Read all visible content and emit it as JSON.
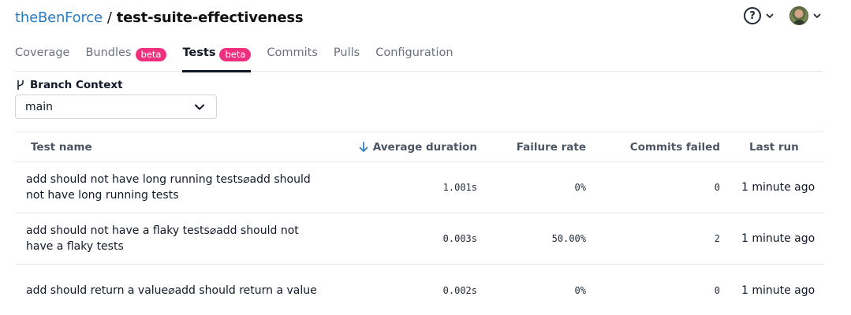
{
  "breadcrumb": {
    "org": "theBenForce",
    "separator": "/",
    "repo": "test-suite-effectiveness"
  },
  "tabs": [
    {
      "label": "Coverage",
      "badge": ""
    },
    {
      "label": "Bundles",
      "badge": "beta"
    },
    {
      "label": "Tests",
      "badge": "beta",
      "active": true
    },
    {
      "label": "Commits",
      "badge": ""
    },
    {
      "label": "Pulls",
      "badge": ""
    },
    {
      "label": "Configuration",
      "badge": ""
    }
  ],
  "help_glyph": "?",
  "branch": {
    "label": "Branch Context",
    "selected": "main"
  },
  "table": {
    "headers": {
      "name": "Test name",
      "duration": "Average duration",
      "failure": "Failure rate",
      "commits": "Commits failed",
      "last_run": "Last run"
    },
    "rows": [
      {
        "name": "add should not have long running tests⌀add should not have long running tests",
        "duration": "1.001s",
        "failure": "0%",
        "commits": "0",
        "last_run": "1 minute ago"
      },
      {
        "name": "add should not have a flaky tests⌀add should not have a flaky tests",
        "duration": "0.003s",
        "failure": "50.00%",
        "commits": "2",
        "last_run": "1 minute ago"
      },
      {
        "name": "add should return a value⌀add should return a value",
        "duration": "0.002s",
        "failure": "0%",
        "commits": "0",
        "last_run": "1 minute ago"
      }
    ]
  },
  "colors": {
    "org_link": "#2a7bbf",
    "badge": "#f0307e",
    "sort_arrow": "#2a7bbf"
  }
}
